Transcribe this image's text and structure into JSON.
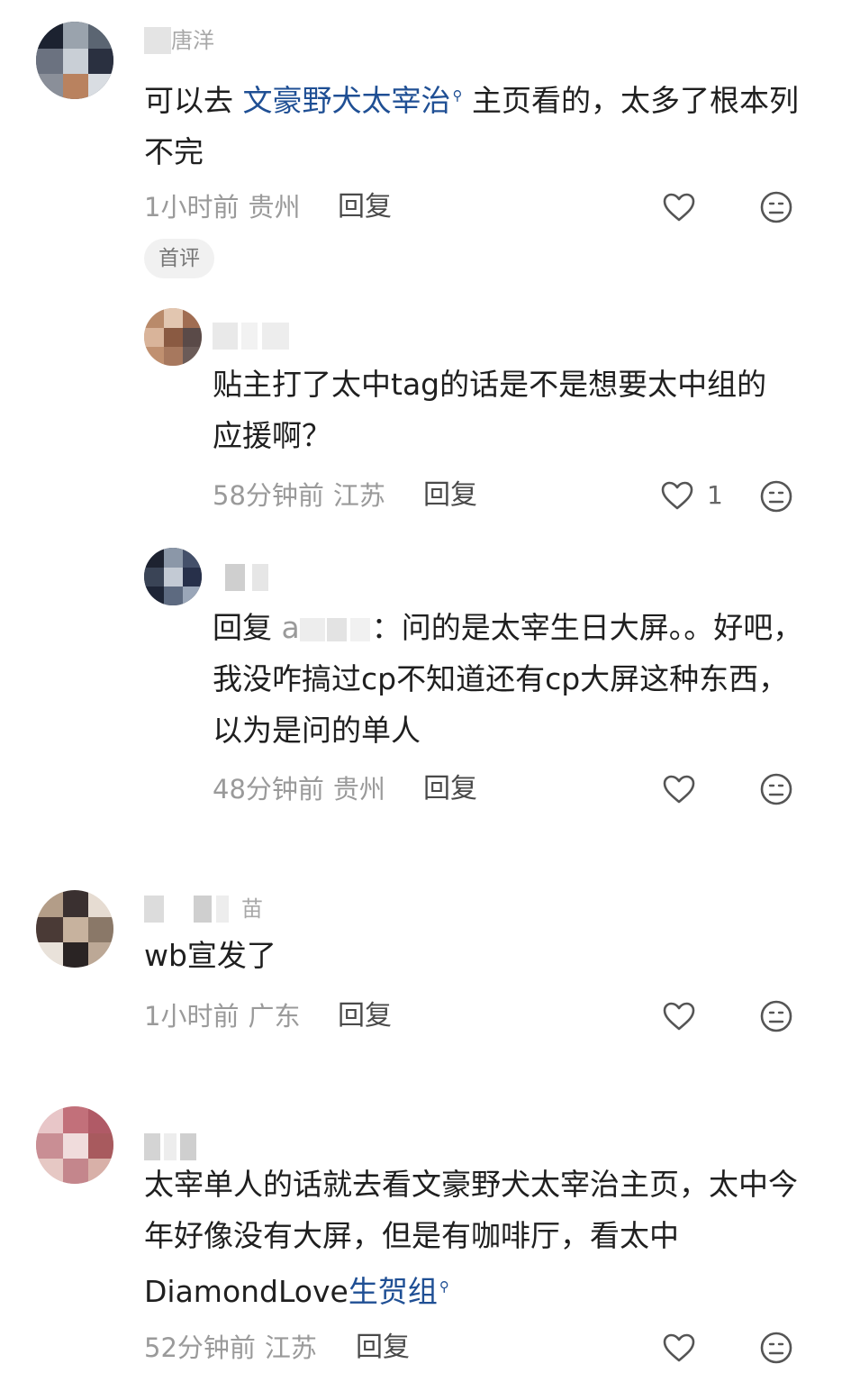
{
  "comments": [
    {
      "username": "唐洋",
      "content_prefix": "可以去 ",
      "link_text": "文豪野犬太宰治",
      "search_icon": "search-icon",
      "content_suffix": " 主页看的，太多了根本列不完",
      "time": "1小时前",
      "location": "贵州",
      "reply_label": "回复",
      "badge": "首评"
    },
    {
      "username": "",
      "content": "贴主打了太中tag的话是不是想要太中组的应援啊？",
      "time": "58分钟前",
      "location": "江苏",
      "reply_label": "回复",
      "likes": "1"
    },
    {
      "username": "",
      "reply_prefix": "回复",
      "reply_to": "a",
      "content": "：问的是太宰生日大屏。。好吧，我没咋搞过cp不知道还有cp大屏这种东西，以为是问的单人",
      "time": "48分钟前",
      "location": "贵州",
      "reply_label": "回复"
    },
    {
      "username": "苗",
      "content": "wb宣发了",
      "time": "1小时前",
      "location": "广东",
      "reply_label": "回复"
    },
    {
      "username": "",
      "content_prefix": "太宰单人的话就去看文豪野犬太宰治主页，太中今年好像没有大屏，但是有咖啡厅，看太中DiamondLove",
      "link_text": "生贺组",
      "search_icon": "search-icon",
      "time": "52分钟前",
      "location": "江苏",
      "reply_label": "回复"
    }
  ],
  "icons": {
    "like": "heart-outline-icon",
    "emoji": "neutral-face-icon"
  },
  "colors": {
    "link": "#1f4f94",
    "meta": "#9a9a9a",
    "text": "#1f1f1f"
  }
}
